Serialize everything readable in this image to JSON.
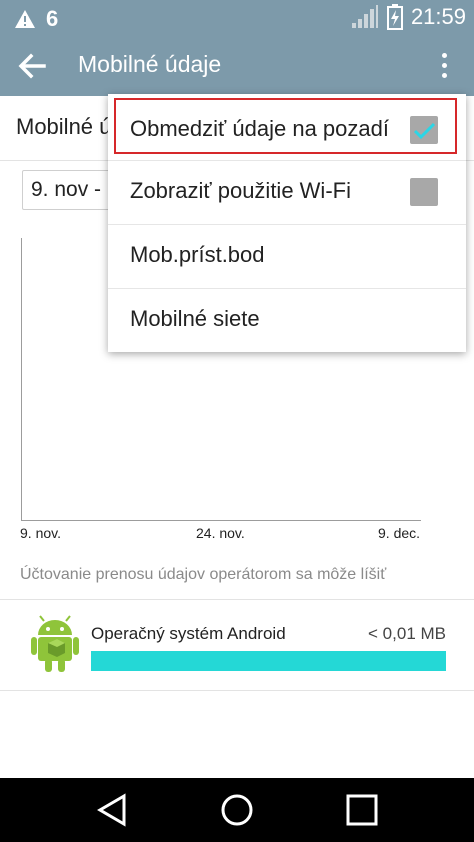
{
  "status_bar": {
    "time": "21:59",
    "icons": [
      "warning-icon",
      "sim-6-icon",
      "signal-icon",
      "battery-charging-icon"
    ],
    "sim_label": "6"
  },
  "app_bar": {
    "title": "Mobilné údaje",
    "back_icon": "back-arrow-icon",
    "overflow_icon": "more-vert-icon"
  },
  "content": {
    "mobile_row_label": "Mobilné ú",
    "date_range_value": "9. nov -",
    "chart_ticks": [
      "9. nov.",
      "24. nov.",
      "9. dec."
    ],
    "notice": "Účtovanie prenosu údajov operátorom sa môže líšiť",
    "apps": [
      {
        "name": "Operačný systém Android",
        "size": "< 0,01 MB",
        "icon": "android-icon",
        "usage_fraction": 1.0
      }
    ]
  },
  "menu": {
    "items": [
      {
        "label": "Obmedziť údaje na pozadí",
        "checkbox": true,
        "checked": true
      },
      {
        "label": "Zobraziť použitie Wi-Fi",
        "checkbox": true,
        "checked": false
      },
      {
        "label": "Mob.príst.bod",
        "checkbox": false
      },
      {
        "label": "Mobilné siete",
        "checkbox": false
      }
    ],
    "highlight_color": "#d6282a"
  },
  "nav_bar": {
    "buttons": [
      "back-triangle-icon",
      "home-circle-icon",
      "recents-square-icon"
    ]
  },
  "colors": {
    "app_bar": "#7d9aaa",
    "usage_bar": "#24d8d6",
    "checkmark": "#2bd6e6"
  }
}
